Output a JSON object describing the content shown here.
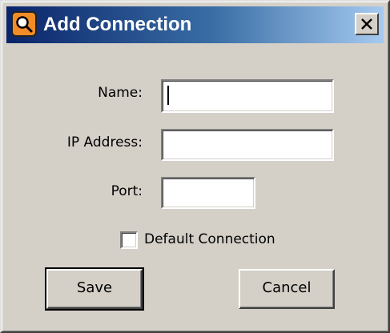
{
  "dialog": {
    "title": "Add Connection",
    "icon": "magnifier-app-icon",
    "close_icon": "close-x-icon"
  },
  "form": {
    "name_label": "Name:",
    "name_value": "",
    "ip_label": "IP Address:",
    "ip_value": "",
    "port_label": "Port:",
    "port_value": "",
    "default_label": "Default Connection",
    "default_checked": false
  },
  "buttons": {
    "save_label": "Save",
    "cancel_label": "Cancel"
  },
  "colors": {
    "titlebar_start": "#0a246a",
    "titlebar_end": "#a6caf0",
    "face": "#d4d0c8",
    "icon_accent": "#f28c28"
  }
}
